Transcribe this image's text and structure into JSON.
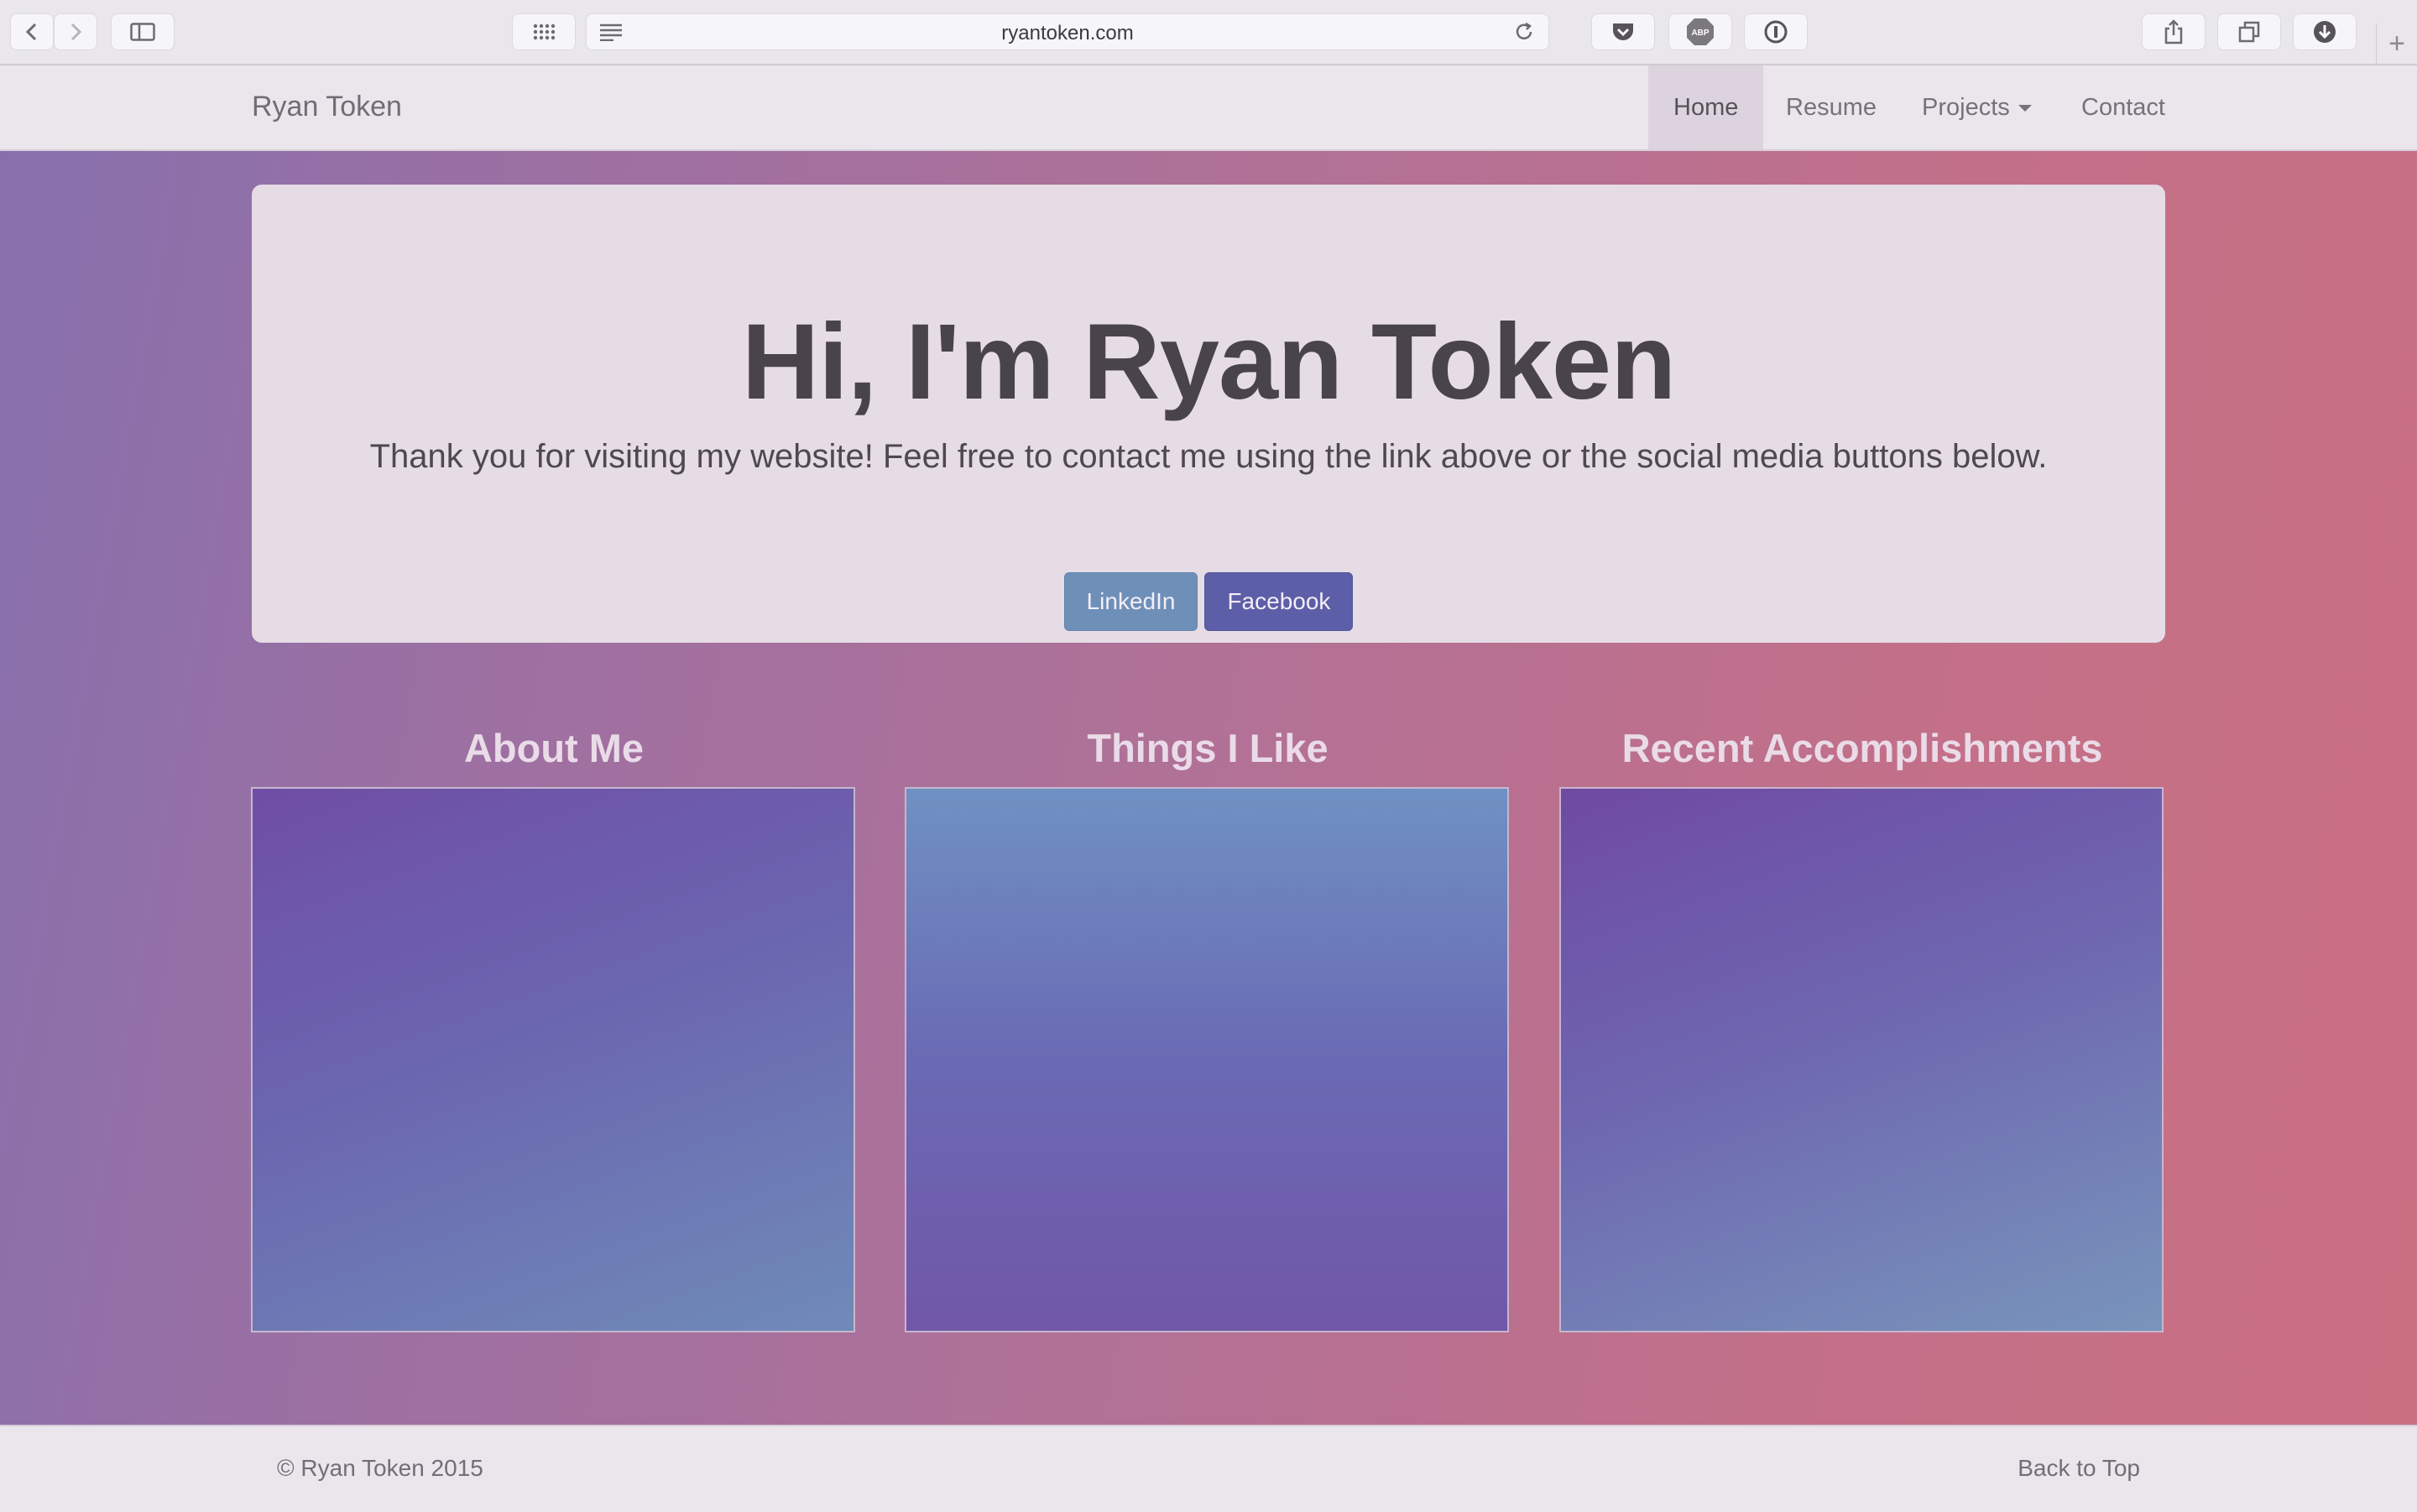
{
  "browser": {
    "url": "ryantoken.com",
    "icons": {
      "back": "chevron-left-icon",
      "forward": "chevron-right-icon",
      "sidebar": "sidebar-icon",
      "top_sites": "grid-icon",
      "reader": "reader-icon",
      "reload": "reload-icon",
      "pocket": "pocket-icon",
      "adblock": "abp-icon",
      "password": "password-icon",
      "share": "share-icon",
      "tabs": "tabs-icon",
      "downloads": "download-icon",
      "new_tab": "plus-icon"
    },
    "adblock_label": "ABP"
  },
  "nav": {
    "brand": "Ryan Token",
    "items": [
      {
        "label": "Home",
        "active": true
      },
      {
        "label": "Resume",
        "active": false
      },
      {
        "label": "Projects",
        "active": false,
        "dropdown": true
      },
      {
        "label": "Contact",
        "active": false
      }
    ]
  },
  "hero": {
    "title": "Hi, I'm Ryan Token",
    "subtitle": "Thank you for visiting my website! Feel free to contact me using the link above or the social media buttons below.",
    "buttons": [
      {
        "label": "LinkedIn",
        "color": "#6e8fb8"
      },
      {
        "label": "Facebook",
        "color": "#5d5ea8"
      }
    ]
  },
  "sections": [
    {
      "title": "About Me",
      "body": ""
    },
    {
      "title": "Things I Like",
      "body": ""
    },
    {
      "title": "Recent Accomplishments",
      "body": ""
    }
  ],
  "footer": {
    "copyright": "© Ryan Token 2015",
    "back_to_top": "Back to Top"
  },
  "colors": {
    "gradient_start": "#8670ad",
    "gradient_end": "#cb6f82",
    "navbar_bg": "#ebe5ec",
    "jumbotron_bg": "#e6dce5"
  }
}
